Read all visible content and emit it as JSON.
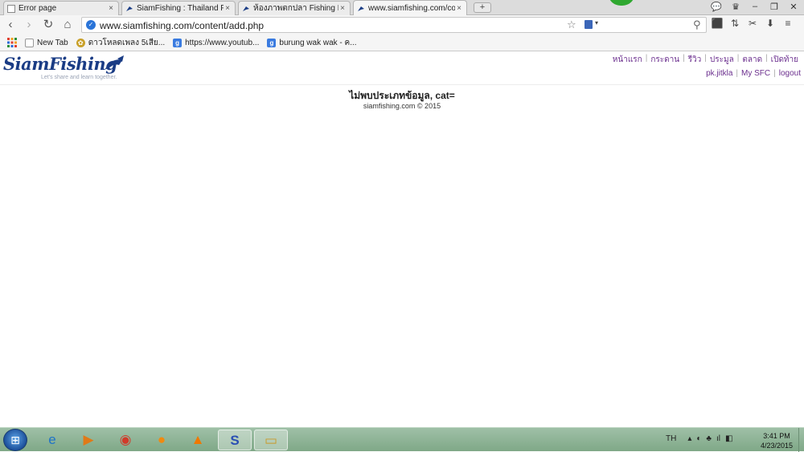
{
  "tabs": [
    {
      "title": "Error page",
      "icon": "page-icon",
      "active": false
    },
    {
      "title": "SiamFishing : Thailand Fis",
      "icon": "siamfishing-favicon",
      "active": false
    },
    {
      "title": "ห้องภาพตกปลา Fishing Phot",
      "icon": "siamfishing-favicon",
      "active": false
    },
    {
      "title": "www.siamfishing.com/co",
      "icon": "siamfishing-favicon",
      "active": true
    }
  ],
  "tab_close": "×",
  "new_tab_label": "+",
  "window_controls": [
    "💬",
    "♛",
    "–",
    "❐",
    "✕"
  ],
  "nav": {
    "back": "‹",
    "forward": "›",
    "reload": "↻",
    "home": "⌂"
  },
  "address": {
    "url": "www.siamfishing.com/content/add.php"
  },
  "omnibox_icons": {
    "star": "☆",
    "ext_arrow": "▾",
    "search": "⚲"
  },
  "toolbar_icons": [
    "⬛",
    "⇅",
    "✂",
    "⬇",
    "≡"
  ],
  "bookmarks": [
    {
      "label": "New Tab",
      "icon": "page-icon"
    },
    {
      "label": "ดาวโหลดเพลง 5เสีย...",
      "icon": "download-favicon"
    },
    {
      "label": "https://www.youtub...",
      "icon": "google-favicon"
    },
    {
      "label": "burung wak wak - ค...",
      "icon": "google-favicon"
    }
  ],
  "site": {
    "logo_text": "SiamFishing",
    "tagline": "Let's share and learn together.",
    "nav": [
      "หน้าแรก",
      "กระดาน",
      "รีวิว",
      "ประมูล",
      "ตลาด",
      "เปิดท้าย"
    ],
    "user": [
      "pk.jitkla",
      "My SFC",
      "logout"
    ],
    "separator": "|",
    "message": "ไม่พบประเภทข้อมูล, cat=",
    "footer": "siamfishing.com © 2015"
  },
  "taskbar": {
    "start_icon": "windows-start-icon",
    "apps": [
      {
        "name": "internet-explorer-icon",
        "glyph": "e",
        "color": "#1f73c8"
      },
      {
        "name": "media-player-icon",
        "glyph": "▶",
        "color": "#e07a18"
      },
      {
        "name": "chrome-icon",
        "glyph": "◉",
        "color": "#d03a2a"
      },
      {
        "name": "orange-ball-icon",
        "glyph": "●",
        "color": "#f08a10"
      },
      {
        "name": "vlc-icon",
        "glyph": "▲",
        "color": "#f07800"
      },
      {
        "name": "app-swirl-icon",
        "glyph": "S",
        "color": "#2a4fb3"
      },
      {
        "name": "file-explorer-icon",
        "glyph": "▭",
        "color": "#d9b24a"
      }
    ],
    "tray_lang": "TH",
    "tray_icons": [
      "▴",
      "◐",
      "♣",
      "ıl",
      "◧"
    ],
    "time": "3:41 PM",
    "date": "4/23/2015"
  }
}
